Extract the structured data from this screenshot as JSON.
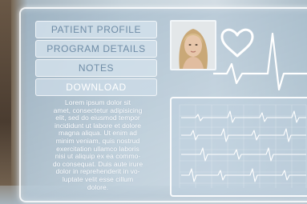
{
  "menu": {
    "patient_profile": "PATIENT PROFILE",
    "program_details": "PROGRAM DETAILS",
    "notes": "NOTES",
    "download": "DOWNLOAD"
  },
  "description": "Lorem ipsum dolor sit\namet, consectetur adipisicing\nelit, sed do eiusmod tempor\nincididunt ut labore et dolore\nmagna aliqua. Ut enim ad\nminim veniam, quis nostrud\nexercitation ullamco laboris\nnisi ut aliquip ex ea commo-\ndo consequat. Duis aute irure\ndolor in reprehenderit in vo-\nluptate velit esse cillum\ndolore.",
  "colors": {
    "accent": "#ffffff",
    "button_text": "#6f8ca6",
    "panel": "#b9cddb"
  },
  "icons": [
    "heart-icon",
    "heartbeat-line-icon",
    "avatar-photo",
    "ecg-monitor"
  ]
}
